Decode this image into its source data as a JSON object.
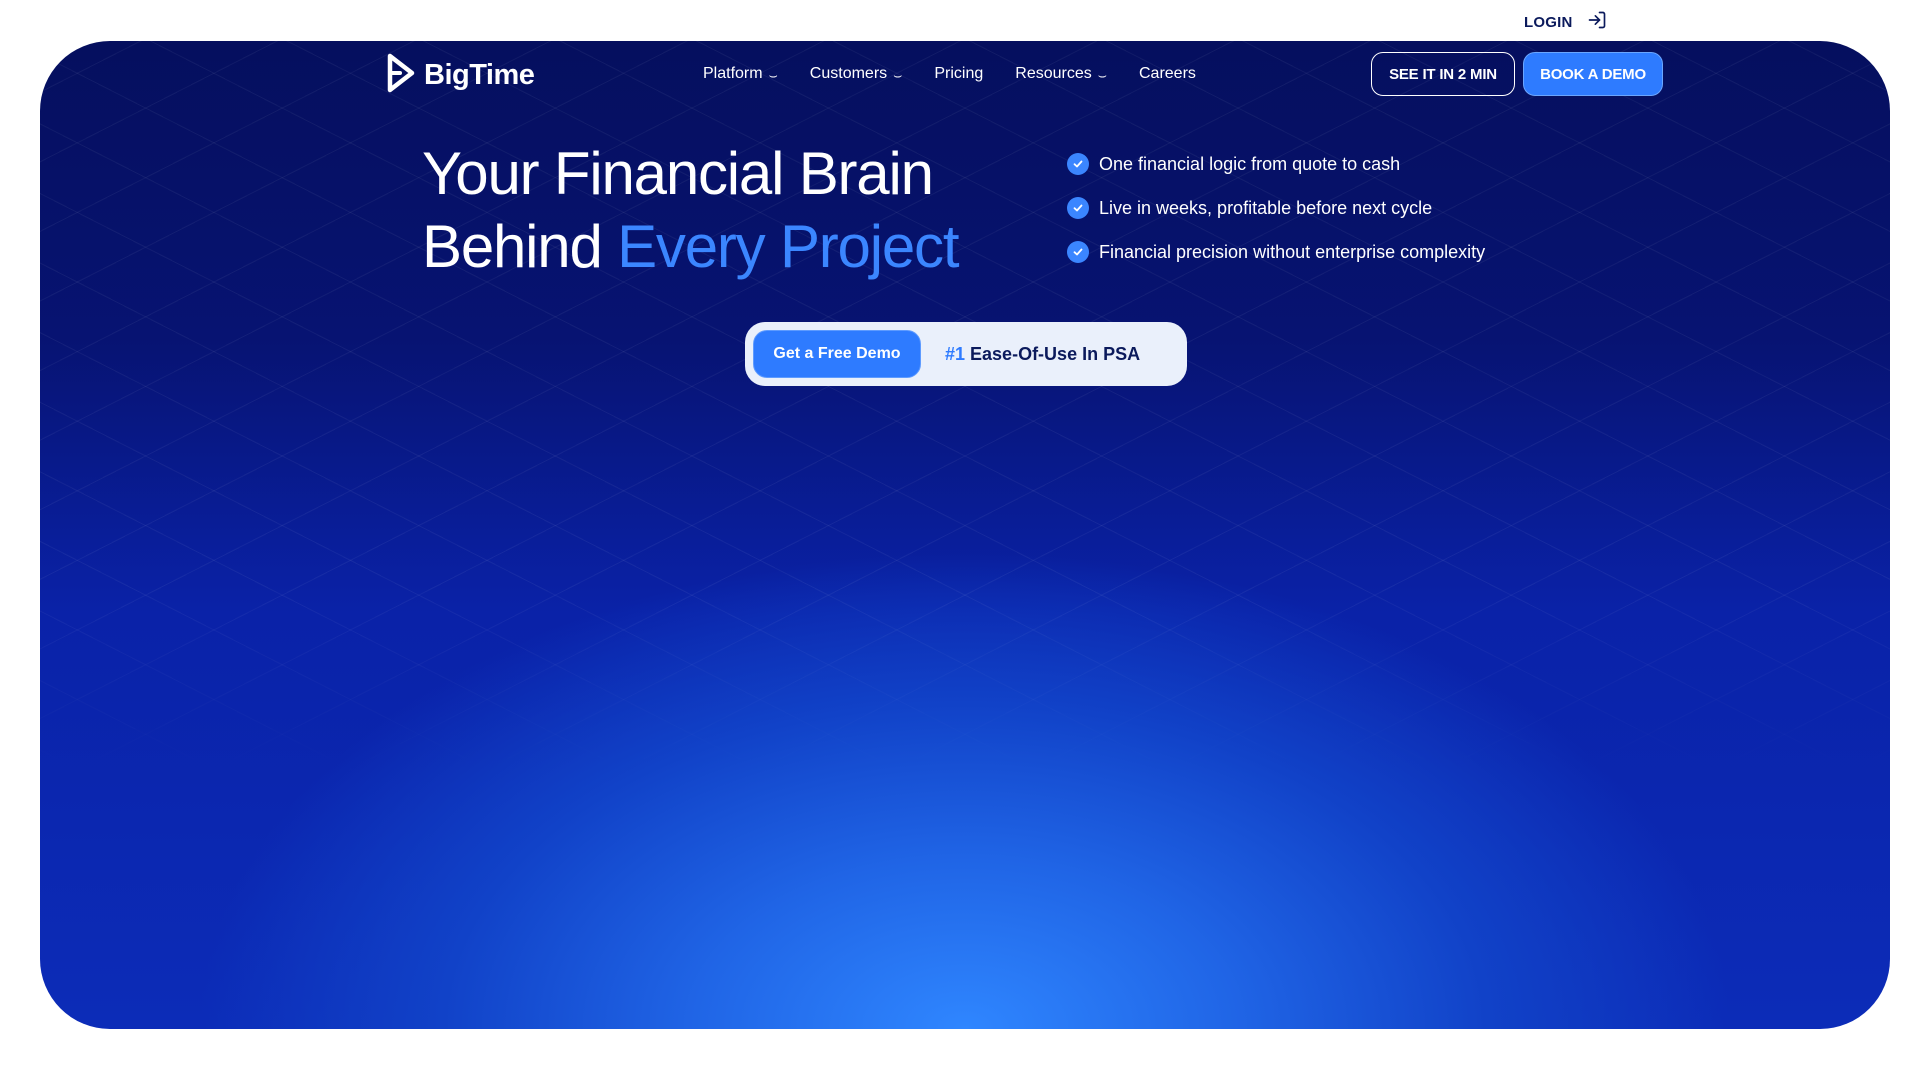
{
  "topbar": {
    "login_label": "LOGIN"
  },
  "brand": {
    "name": "BigTime"
  },
  "nav": {
    "items": [
      {
        "label": "Platform",
        "has_dropdown": true
      },
      {
        "label": "Customers",
        "has_dropdown": true
      },
      {
        "label": "Pricing",
        "has_dropdown": false
      },
      {
        "label": "Resources",
        "has_dropdown": true
      },
      {
        "label": "Careers",
        "has_dropdown": false
      }
    ],
    "chevron_glyph": "⌣"
  },
  "header_buttons": {
    "see_it": "SEE IT IN 2 MIN",
    "book_demo": "BOOK A DEMO"
  },
  "hero": {
    "headline_line1": "Your Financial Brain",
    "headline_line2_plain": "Behind ",
    "headline_line2_accent": "Every Project",
    "checklist": [
      "One financial logic from quote to cash",
      "Live in weeks, profitable before next cycle",
      "Financial precision without enterprise complexity"
    ],
    "cta_button": "Get a Free Demo",
    "badge_number": "#1",
    "badge_text": " Ease-Of-Use In PSA"
  },
  "colors": {
    "accent": "#2e7bff",
    "headline_accent": "#3b86ff",
    "hero_dark": "#050f5e",
    "hero_glow": "#2f86ff",
    "dark_text": "#0b1a5c"
  },
  "icons": [
    "login-icon",
    "bigtime-logo-icon",
    "chevron-down-icon",
    "check-circle-icon"
  ]
}
